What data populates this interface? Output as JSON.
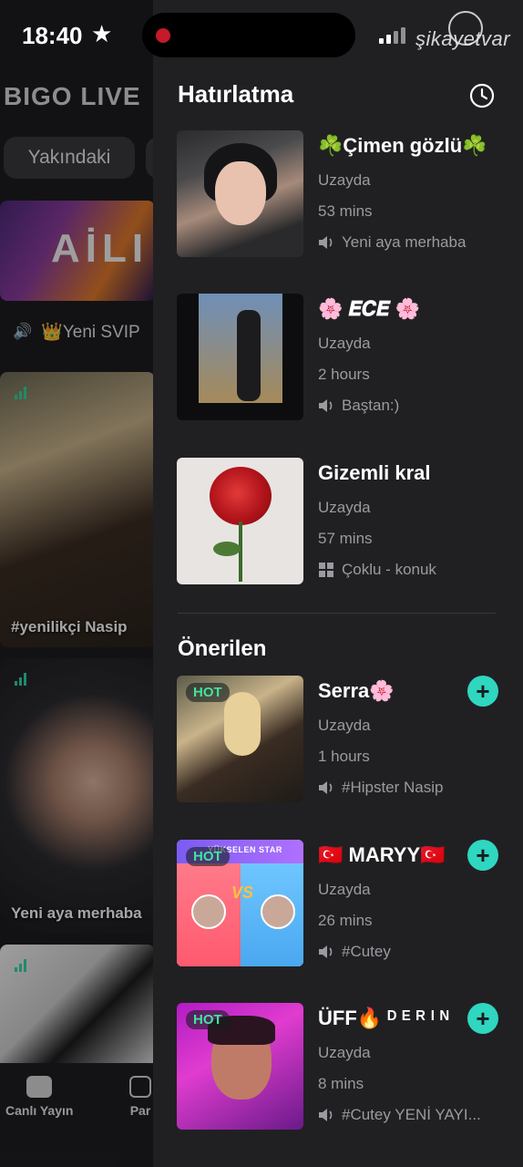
{
  "status_bar": {
    "time": "18:40",
    "watermark": "şikayetvar"
  },
  "background_app": {
    "brand": "BIGO LIVE",
    "pill_tab": "Yakındaki",
    "banner_text": "AİLI",
    "ticker": "👑Yeni SVIP",
    "cards": [
      {
        "caption": "#yenilikçi Nasip"
      },
      {
        "caption": "Yeni aya merhaba"
      },
      {
        "caption": ""
      }
    ],
    "tabbar": [
      {
        "label": "Canlı Yayın"
      },
      {
        "label": "Par"
      }
    ]
  },
  "drawer": {
    "title": "Hatırlatma",
    "reminders": [
      {
        "name": "☘️Çimen gözlü☘️",
        "location": "Uzayda",
        "duration": "53 mins",
        "tag": "Yeni aya merhaba",
        "tag_icon": "speaker-icon"
      },
      {
        "name": "🌸 𝑬𝑪𝑬 🌸",
        "location": "Uzayda",
        "duration": "2 hours",
        "tag": "Baştan:)",
        "tag_icon": "speaker-icon"
      },
      {
        "name": "Gizemli kral",
        "location": "Uzayda",
        "duration": "57 mins",
        "tag": "Çoklu - konuk",
        "tag_icon": "grid-icon"
      }
    ],
    "suggested_title": "Önerilen",
    "suggested": [
      {
        "name": "Serra🌸",
        "location": "Uzayda",
        "duration": "1 hours",
        "tag": "#Hipster Nasip",
        "badge": "HOT"
      },
      {
        "name": "🇹🇷 MARYY🇹🇷",
        "location": "Uzayda",
        "duration": "26 mins",
        "tag": "#Cutey",
        "badge": "HOT",
        "thumb_banner": "YÜKSELEN STAR"
      },
      {
        "name": "ÜFF🔥 ᴰ ᴱ ᴿ ᴵ ᴺ",
        "location": "Uzayda",
        "duration": "8 mins",
        "tag": "#Cutey YENİ YAYI...",
        "badge": "HOT"
      }
    ],
    "follow_symbol": "+"
  },
  "colors": {
    "drawer_bg": "#202023",
    "accent_follow": "#2fd6c0",
    "hot_badge": "#42e39c",
    "secondary_text": "#9a9aa0"
  }
}
